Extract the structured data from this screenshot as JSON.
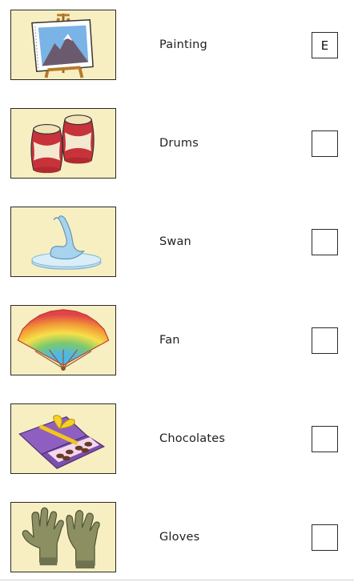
{
  "items": [
    {
      "label": "Painting",
      "answer": "E",
      "icon": "painting-easel"
    },
    {
      "label": "Drums",
      "answer": "",
      "icon": "drums"
    },
    {
      "label": "Swan",
      "answer": "",
      "icon": "glass-swan"
    },
    {
      "label": "Fan",
      "answer": "",
      "icon": "hand-fan"
    },
    {
      "label": "Chocolates",
      "answer": "",
      "icon": "chocolate-box"
    },
    {
      "label": "Gloves",
      "answer": "",
      "icon": "gloves"
    }
  ],
  "colors": {
    "picture_background": "#f7efc2",
    "border": "#2a2a2a"
  }
}
